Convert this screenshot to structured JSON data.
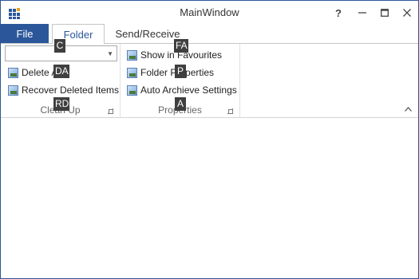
{
  "window": {
    "title": "MainWindow",
    "help_label": "?",
    "minimize_label": "—",
    "maximize_label": "☐",
    "close_label": "✕"
  },
  "tabs": [
    {
      "label": "File",
      "selected": false
    },
    {
      "label": "Folder",
      "selected": true
    },
    {
      "label": "Send/Receive",
      "selected": false
    }
  ],
  "ribbon": {
    "groups": [
      {
        "label": "Clean Up",
        "combo_value": "",
        "buttons": [
          {
            "label": "Delete All"
          },
          {
            "label": "Recover Deleted Items"
          }
        ]
      },
      {
        "label": "Properties",
        "buttons": [
          {
            "label": "Show in Favourites"
          },
          {
            "label": "Folder Properties"
          },
          {
            "label": "Auto Archieve Settings"
          }
        ]
      }
    ],
    "collapse_label": "^"
  },
  "keytips": {
    "combo": "C",
    "show_in_favourites": "FA",
    "delete_all": "DA",
    "folder_properties": "P",
    "recover_deleted_items": "RD",
    "auto_archieve_settings": "A"
  },
  "colors": {
    "accent": "#2b579a",
    "keytip_bg": "#3f3f3f"
  }
}
